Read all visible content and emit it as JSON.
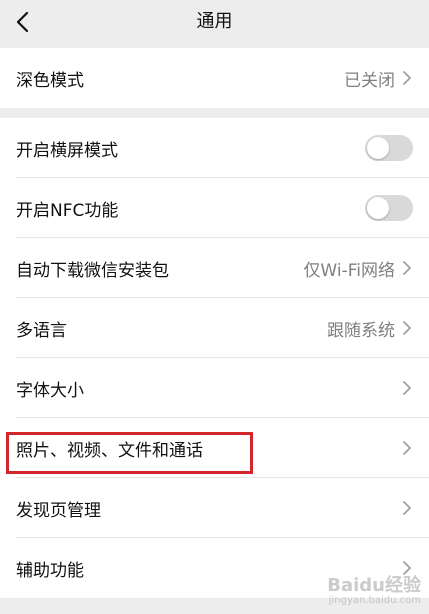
{
  "header": {
    "title": "通用"
  },
  "dark_mode": {
    "label": "深色模式",
    "value": "已关闭"
  },
  "settings": [
    {
      "label": "开启横屏模式",
      "type": "toggle",
      "on": false
    },
    {
      "label": "开启NFC功能",
      "type": "toggle",
      "on": false
    },
    {
      "label": "自动下载微信安装包",
      "type": "value",
      "value": "仅Wi-Fi网络"
    },
    {
      "label": "多语言",
      "type": "value",
      "value": "跟随系统"
    },
    {
      "label": "字体大小",
      "type": "chevron"
    },
    {
      "label": "照片、视频、文件和通话",
      "type": "chevron"
    },
    {
      "label": "发现页管理",
      "type": "chevron"
    },
    {
      "label": "辅助功能",
      "type": "chevron"
    }
  ],
  "watermark": {
    "text": "Baidu经验",
    "url": "jingyan.baidu.com"
  },
  "colors": {
    "background": "#ededed",
    "highlight": "#d2262d",
    "toggle_off": "#d9d9d9"
  }
}
